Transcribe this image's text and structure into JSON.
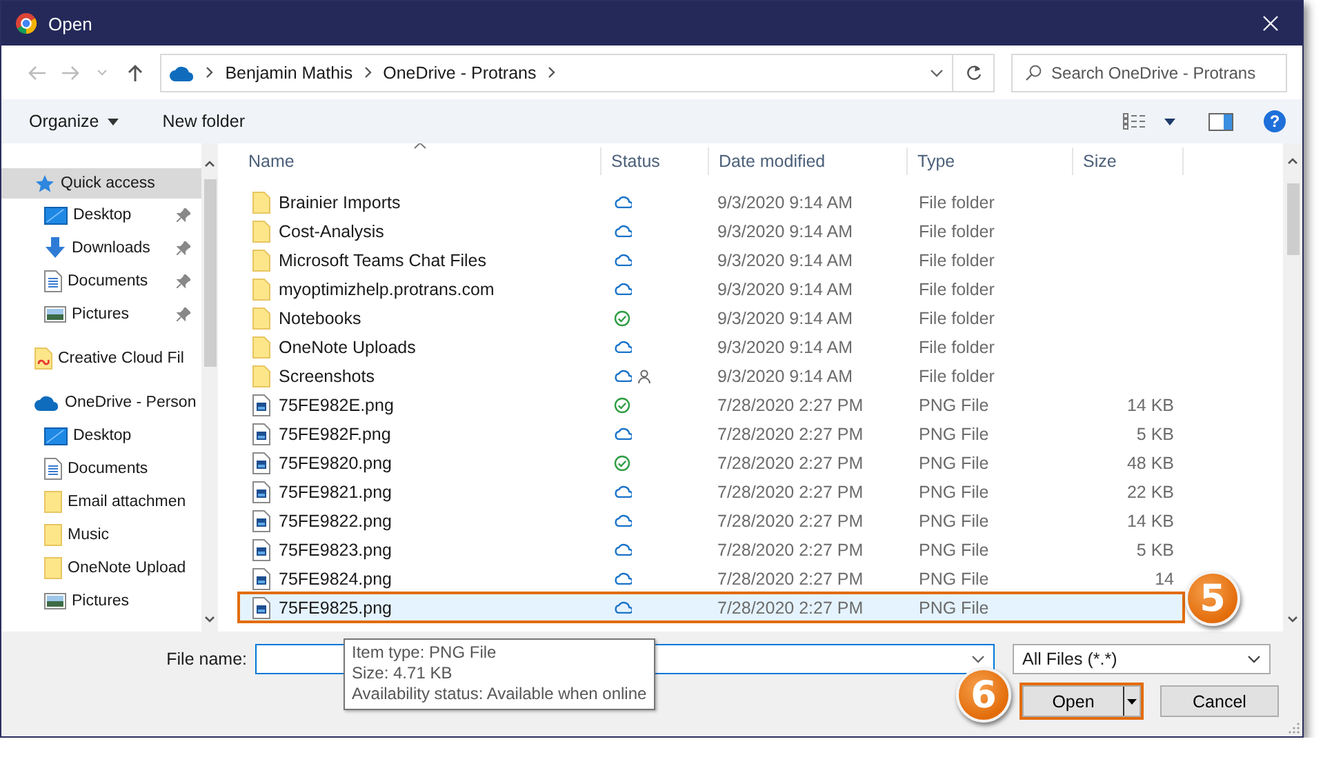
{
  "window": {
    "title": "Open"
  },
  "address": {
    "path": [
      "Benjamin Mathis",
      "OneDrive - Protrans"
    ]
  },
  "search": {
    "placeholder": "Search OneDrive - Protrans"
  },
  "toolbar": {
    "buttons": [
      {
        "label": "Organize",
        "menu": true
      },
      {
        "label": "New folder",
        "menu": false
      }
    ],
    "help": "?"
  },
  "nav": [
    {
      "label": "Quick access",
      "kind": "star",
      "selected": true,
      "children": [
        {
          "label": "Desktop",
          "kind": "desktop",
          "pinned": true
        },
        {
          "label": "Downloads",
          "kind": "download",
          "pinned": true
        },
        {
          "label": "Documents",
          "kind": "document",
          "pinned": true
        },
        {
          "label": "Pictures",
          "kind": "pictures",
          "pinned": true
        }
      ]
    },
    {
      "label": "Creative Cloud Fil",
      "kind": "cc-folder",
      "selected": false
    },
    {
      "label": "OneDrive - Person",
      "kind": "onedrive",
      "selected": false,
      "children": [
        {
          "label": "Desktop",
          "kind": "desktop",
          "pinned": false
        },
        {
          "label": "Documents",
          "kind": "document",
          "pinned": false
        },
        {
          "label": "Email attachmen",
          "kind": "folder",
          "pinned": false
        },
        {
          "label": "Music",
          "kind": "folder",
          "pinned": false
        },
        {
          "label": "OneNote Upload",
          "kind": "folder",
          "pinned": false
        },
        {
          "label": "Pictures",
          "kind": "pictures",
          "pinned": false
        }
      ]
    }
  ],
  "columns": [
    {
      "label": "Name",
      "sorted": true
    },
    {
      "label": "Status",
      "sorted": false
    },
    {
      "label": "Date modified",
      "sorted": false
    },
    {
      "label": "Type",
      "sorted": false
    },
    {
      "label": "Size",
      "sorted": false
    }
  ],
  "files": [
    {
      "name": "Brainier Imports",
      "kind": "folder",
      "online_only": true,
      "shared": false,
      "date": "9/3/2020 9:14 AM",
      "type": "File folder",
      "selected": false,
      "highlighted": false
    },
    {
      "name": "Cost-Analysis",
      "kind": "folder",
      "online_only": true,
      "shared": false,
      "date": "9/3/2020 9:14 AM",
      "type": "File folder",
      "selected": false,
      "highlighted": false
    },
    {
      "name": "Microsoft Teams Chat Files",
      "kind": "folder",
      "online_only": true,
      "shared": false,
      "date": "9/3/2020 9:14 AM",
      "type": "File folder",
      "selected": false,
      "highlighted": false
    },
    {
      "name": "myoptimizhelp.protrans.com",
      "kind": "folder",
      "online_only": true,
      "shared": false,
      "date": "9/3/2020 9:14 AM",
      "type": "File folder",
      "selected": false,
      "highlighted": false
    },
    {
      "name": "Notebooks",
      "kind": "folder",
      "online_only": false,
      "shared": false,
      "date": "9/3/2020 9:14 AM",
      "type": "File folder",
      "selected": false,
      "highlighted": false
    },
    {
      "name": "OneNote Uploads",
      "kind": "folder",
      "online_only": true,
      "shared": false,
      "date": "9/3/2020 9:14 AM",
      "type": "File folder",
      "selected": false,
      "highlighted": false
    },
    {
      "name": "Screenshots",
      "kind": "folder",
      "online_only": true,
      "shared": true,
      "date": "9/3/2020 9:14 AM",
      "type": "File folder",
      "selected": false,
      "highlighted": false
    },
    {
      "name": "75FE982E.png",
      "kind": "image",
      "online_only": false,
      "shared": false,
      "date": "7/28/2020 2:27 PM",
      "type": "PNG File",
      "size": "14 KB",
      "selected": false,
      "highlighted": false
    },
    {
      "name": "75FE982F.png",
      "kind": "image",
      "online_only": true,
      "shared": false,
      "date": "7/28/2020 2:27 PM",
      "type": "PNG File",
      "size": "5 KB",
      "selected": false,
      "highlighted": false
    },
    {
      "name": "75FE9820.png",
      "kind": "image",
      "online_only": false,
      "shared": false,
      "date": "7/28/2020 2:27 PM",
      "type": "PNG File",
      "size": "48 KB",
      "selected": false,
      "highlighted": false
    },
    {
      "name": "75FE9821.png",
      "kind": "image",
      "online_only": true,
      "shared": false,
      "date": "7/28/2020 2:27 PM",
      "type": "PNG File",
      "size": "22 KB",
      "selected": false,
      "highlighted": false
    },
    {
      "name": "75FE9822.png",
      "kind": "image",
      "online_only": true,
      "shared": false,
      "date": "7/28/2020 2:27 PM",
      "type": "PNG File",
      "size": "14 KB",
      "selected": false,
      "highlighted": false
    },
    {
      "name": "75FE9823.png",
      "kind": "image",
      "online_only": true,
      "shared": false,
      "date": "7/28/2020 2:27 PM",
      "type": "PNG File",
      "size": "5 KB",
      "selected": false,
      "highlighted": false
    },
    {
      "name": "75FE9824.png",
      "kind": "image",
      "online_only": true,
      "shared": false,
      "date": "7/28/2020 2:27 PM",
      "type": "PNG File",
      "size": "14",
      "selected": false,
      "highlighted": false
    },
    {
      "name": "75FE9825.png",
      "kind": "image",
      "online_only": true,
      "shared": false,
      "date": "7/28/2020 2:27 PM",
      "type": "PNG File",
      "selected": true,
      "highlighted": true
    }
  ],
  "file_name": {
    "label": "File name:"
  },
  "filter": {
    "value": "All Files (*.*)"
  },
  "buttons": [
    {
      "label": "Open",
      "kind": "split",
      "highlighted": true
    },
    {
      "label": "Cancel",
      "kind": "plain",
      "highlighted": false
    }
  ],
  "tooltip": {
    "lines": [
      "Item type: PNG File",
      "Size: 4.71 KB",
      "Availability status: Available when online"
    ]
  },
  "callouts": [
    {
      "text": "5"
    },
    {
      "text": "6"
    }
  ]
}
